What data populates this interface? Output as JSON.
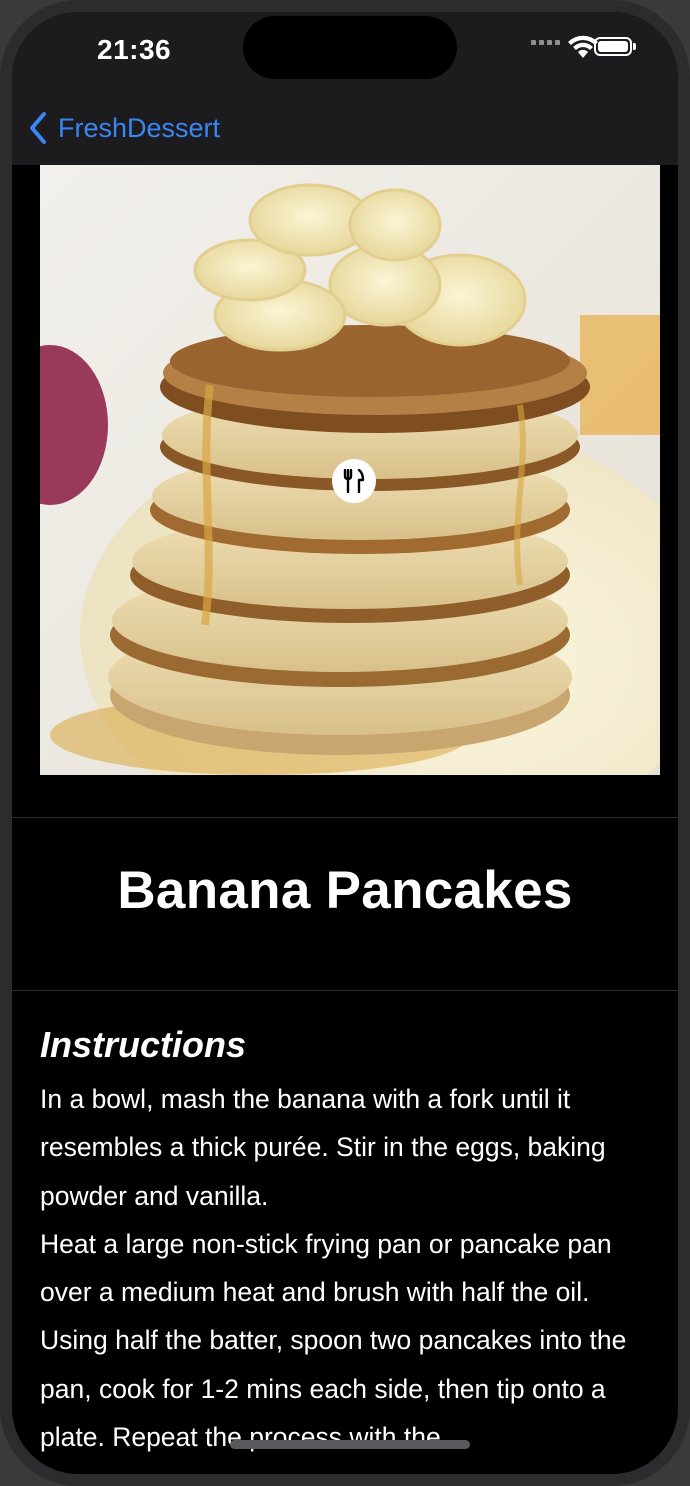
{
  "status_bar": {
    "time": "21:36"
  },
  "nav": {
    "back_label": "FreshDessert"
  },
  "recipe": {
    "title": "Banana Pancakes",
    "instructions_heading": "Instructions",
    "instructions": "In a bowl, mash the banana with a fork until it resembles a thick purée. Stir in the eggs, baking powder and vanilla.\nHeat a large non-stick frying pan or pancake pan over a medium heat and brush with half the oil. Using half the batter, spoon two pancakes into the pan, cook for 1-2 mins each side, then tip onto a plate. Repeat the process with the"
  },
  "icons": {
    "back": "chevron-left-icon",
    "badge": "fork-knife-icon",
    "wifi": "wifi-icon",
    "battery": "battery-icon",
    "signal": "cellular-signal-icon"
  },
  "colors": {
    "accent": "#3a86f5",
    "background": "#000000",
    "bar": "#1c1c1e"
  }
}
